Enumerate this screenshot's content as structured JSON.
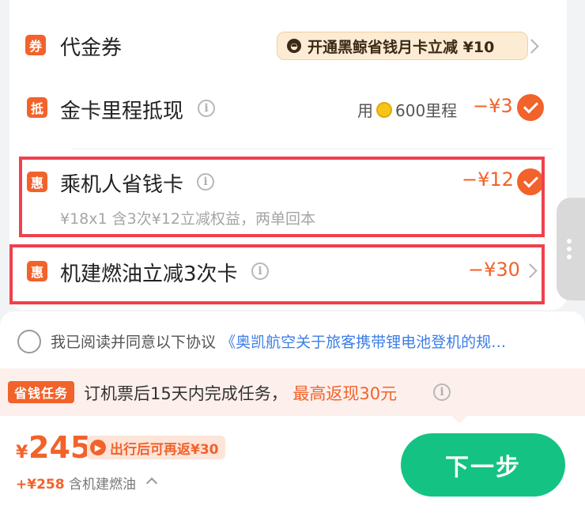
{
  "voucher": {
    "tag": "券",
    "label": "代金券",
    "promo_text_a": "开通黑鲸省钱月卡立减",
    "promo_text_b": "¥10",
    "icon": "whale-icon"
  },
  "mileage": {
    "tag": "抵",
    "label": "金卡里程抵现",
    "use_prefix": "用",
    "use_suffix": "600里程",
    "amount": "−¥3",
    "checked": true
  },
  "saver_card": {
    "tag": "惠",
    "label": "乘机人省钱卡",
    "amount": "−¥12",
    "sub": "¥18x1 含3次¥12立减权益，两单回本",
    "checked": true
  },
  "fuel_card": {
    "tag": "惠",
    "label": "机建燃油立减3次卡",
    "amount": "−¥30"
  },
  "agreement": {
    "text": "我已阅读并同意以下协议",
    "link": "《奥凯航空关于旅客携带锂电池登机的规…"
  },
  "task": {
    "badge": "省钱任务",
    "text": "订机票后15天内完成任务，",
    "highlight": "最高返现30元"
  },
  "footer": {
    "currency": "¥",
    "price": "245",
    "rebate_text": "出行后可再返¥30",
    "tax_amount": "+¥258",
    "tax_label": "含机建燃油",
    "next_label": "下一步"
  },
  "colors": {
    "accent": "#f2622b",
    "highlight_border": "#f0414c",
    "primary_button": "#14c383",
    "link": "#3c7ee6"
  }
}
